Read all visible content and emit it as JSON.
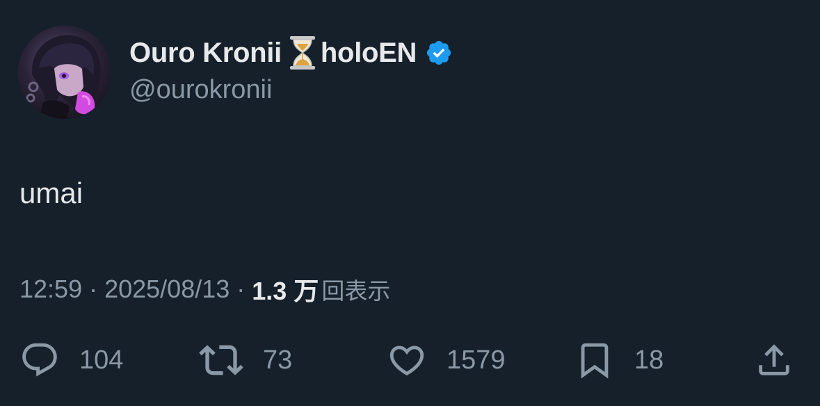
{
  "user": {
    "display_name": "Ouro Kronii",
    "display_name_suffix": "holoEN",
    "emoji_icon": "hourglass-icon",
    "verified_icon": "verified-badge-icon",
    "handle": "@ourokronii"
  },
  "tweet": {
    "text": "umai"
  },
  "meta": {
    "time": "12:59",
    "separator_1": "·",
    "date": "2025/08/13",
    "separator_2": "·",
    "views_count": "1.3 万",
    "views_label": "回表示"
  },
  "actions": {
    "reply": {
      "icon": "reply-icon",
      "count": "104"
    },
    "retweet": {
      "icon": "retweet-icon",
      "count": "73"
    },
    "like": {
      "icon": "heart-icon",
      "count": "1579"
    },
    "bookmark": {
      "icon": "bookmark-icon",
      "count": "18"
    },
    "share": {
      "icon": "share-icon"
    }
  },
  "colors": {
    "background": "#15202b",
    "primary_text": "#e7e9ea",
    "secondary_text": "#8b98a5",
    "verified_blue": "#1d9bf0"
  }
}
